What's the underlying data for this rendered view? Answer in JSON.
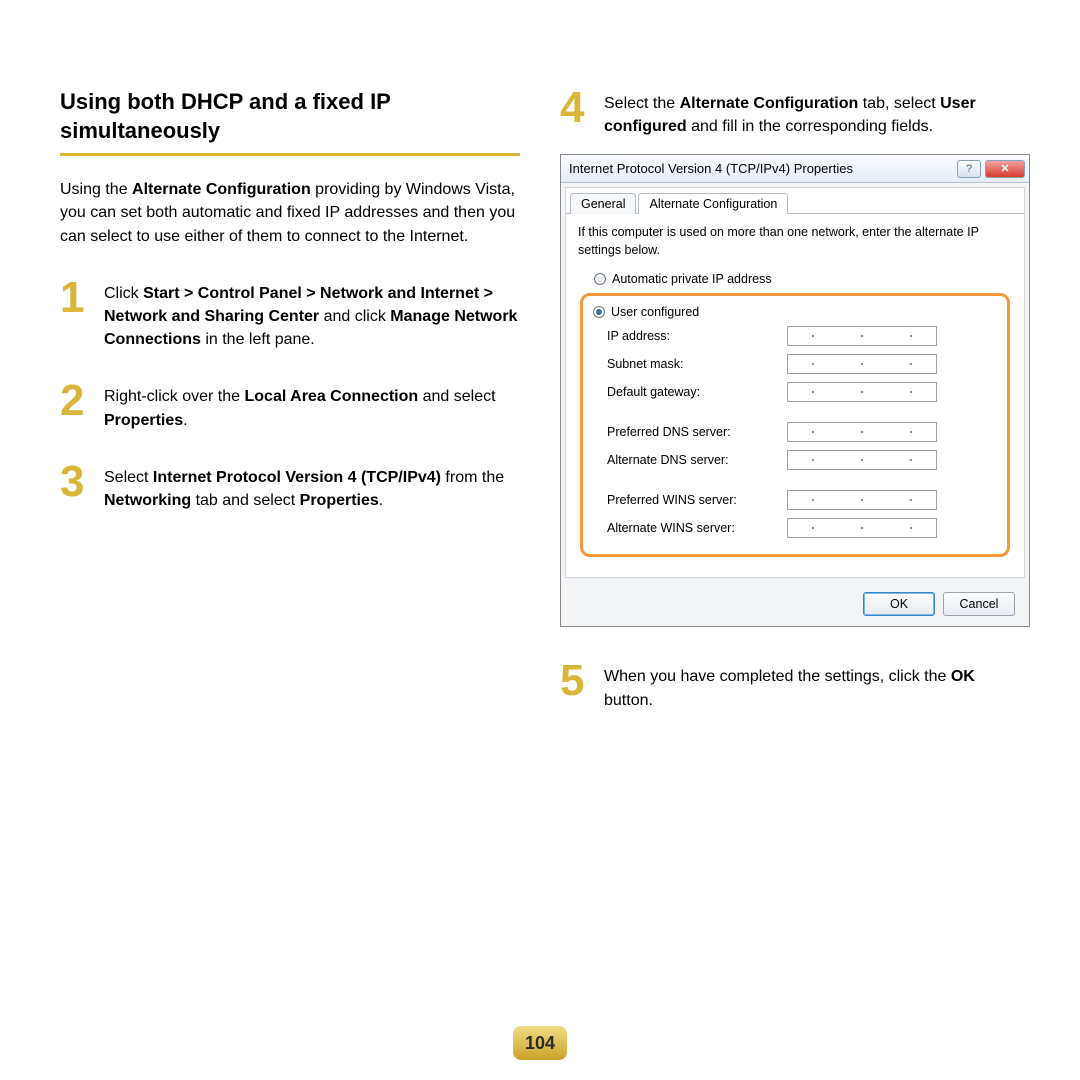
{
  "page_number": "104",
  "left": {
    "title": "Using both DHCP and a fixed IP simultaneously",
    "intro_pre": "Using the ",
    "intro_b1": "Alternate Configuration",
    "intro_post": " providing by Windows Vista, you can set both automatic and fixed IP addresses and then you can select to use either of them to connect to the Internet.",
    "step1_num": "1",
    "step1_t1": "Click ",
    "step1_b1": "Start > Control Panel > Network and Internet > Network and Sharing Center",
    "step1_t2": " and click ",
    "step1_b2": "Manage Network Connections",
    "step1_t3": " in the left pane.",
    "step2_num": "2",
    "step2_t1": "Right-click over the ",
    "step2_b1": "Local Area Connection",
    "step2_t2": " and select ",
    "step2_b2": "Properties",
    "step2_t3": ".",
    "step3_num": "3",
    "step3_t1": "Select ",
    "step3_b1": "Internet Protocol Version 4 (TCP/IPv4)",
    "step3_t2": " from the ",
    "step3_b2": "Networking",
    "step3_t3": " tab and select ",
    "step3_b3": "Properties",
    "step3_t4": "."
  },
  "right": {
    "step4_num": "4",
    "step4_t1": "Select the ",
    "step4_b1": "Alternate Configuration",
    "step4_t2": " tab, select ",
    "step4_b2": "User configured",
    "step4_t3": " and fill in the corresponding fields.",
    "step5_num": "5",
    "step5_t1": "When you have completed the settings, click the ",
    "step5_b1": "OK",
    "step5_t2": " button."
  },
  "dialog": {
    "title": "Internet Protocol Version 4 (TCP/IPv4) Properties",
    "help_glyph": "?",
    "close_glyph": "✕",
    "tab_general": "General",
    "tab_altconf": "Alternate Configuration",
    "note": "If this computer is used on more than one network, enter the alternate IP settings below.",
    "radio_auto": "Automatic private IP address",
    "radio_user": "User configured",
    "lbl_ip": "IP address:",
    "lbl_subnet": "Subnet mask:",
    "lbl_gateway": "Default gateway:",
    "lbl_pref_dns": "Preferred DNS server:",
    "lbl_alt_dns": "Alternate DNS server:",
    "lbl_pref_wins": "Preferred WINS server:",
    "lbl_alt_wins": "Alternate WINS server:",
    "btn_ok": "OK",
    "btn_cancel": "Cancel"
  }
}
